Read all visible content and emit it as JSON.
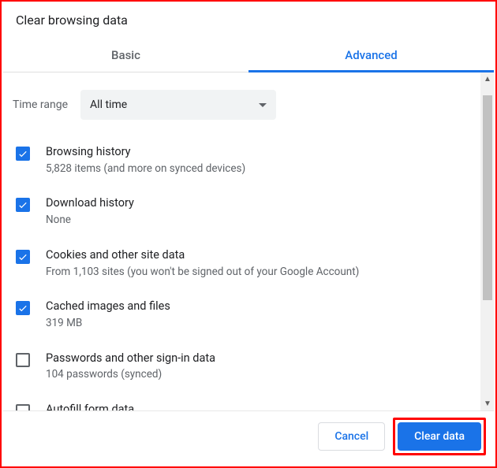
{
  "title": "Clear browsing data",
  "tabs": {
    "basic": "Basic",
    "advanced": "Advanced",
    "active": "advanced"
  },
  "timerange": {
    "label": "Time range",
    "value": "All time"
  },
  "items": [
    {
      "label": "Browsing history",
      "desc": "5,828 items (and more on synced devices)",
      "checked": true
    },
    {
      "label": "Download history",
      "desc": "None",
      "checked": true
    },
    {
      "label": "Cookies and other site data",
      "desc": "From 1,103 sites (you won't be signed out of your Google Account)",
      "checked": true
    },
    {
      "label": "Cached images and files",
      "desc": "319 MB",
      "checked": true
    },
    {
      "label": "Passwords and other sign-in data",
      "desc": "104 passwords (synced)",
      "checked": false
    },
    {
      "label": "Autofill form data",
      "desc": "",
      "checked": false
    }
  ],
  "footer": {
    "cancel": "Cancel",
    "clear": "Clear data"
  }
}
